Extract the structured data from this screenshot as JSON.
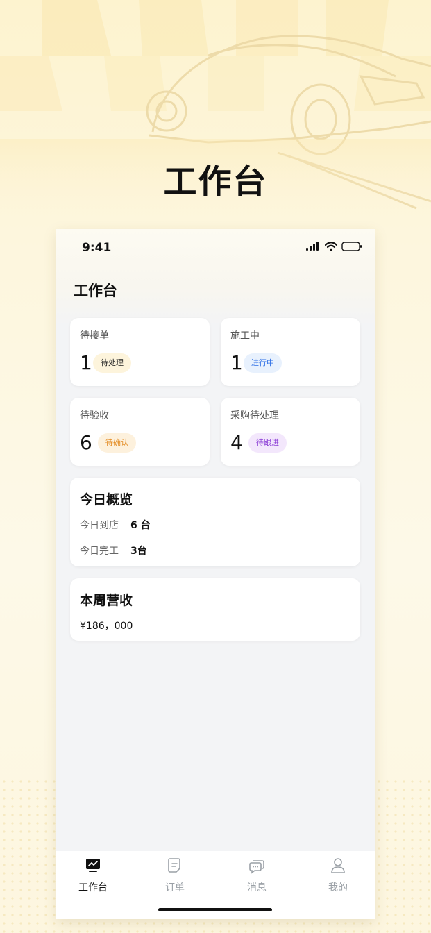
{
  "hero": {
    "title": "工作台"
  },
  "status_bar": {
    "time": "9:41"
  },
  "page": {
    "title": "工作台"
  },
  "stats": [
    {
      "label": "待接单",
      "value": "1",
      "badge": "待处理",
      "badge_color": "#222222"
    },
    {
      "label": "施工中",
      "value": "1",
      "badge": "进行中",
      "badge_color": "#2d6fe6"
    },
    {
      "label": "待验收",
      "value": "6",
      "badge": "待确认",
      "badge_color": "#e38b22"
    },
    {
      "label": "采购待处理",
      "value": "4",
      "badge": "待跟进",
      "badge_color": "#8c3fd6"
    }
  ],
  "overview": {
    "title": "今日概览",
    "rows": [
      {
        "label": "今日到店",
        "value": "6 台"
      },
      {
        "label": "今日完工",
        "value": "3台"
      }
    ]
  },
  "revenue": {
    "title": "本周营收",
    "amount": "¥186，000"
  },
  "tabbar": {
    "items": [
      {
        "label": "工作台",
        "icon": "monitor-chart-icon",
        "active": true
      },
      {
        "label": "订单",
        "icon": "document-icon",
        "active": false
      },
      {
        "label": "消息",
        "icon": "chat-bubbles-icon",
        "active": false
      },
      {
        "label": "我的",
        "icon": "user-icon",
        "active": false
      }
    ]
  }
}
